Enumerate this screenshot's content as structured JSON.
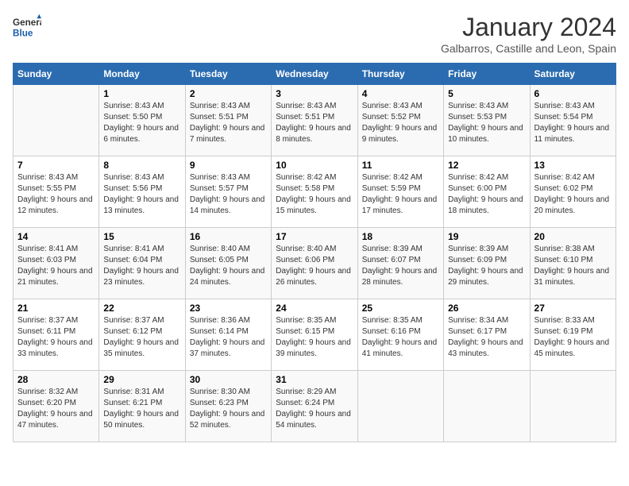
{
  "header": {
    "logo_line1": "General",
    "logo_line2": "Blue",
    "month_year": "January 2024",
    "location": "Galbarros, Castille and Leon, Spain"
  },
  "days_of_week": [
    "Sunday",
    "Monday",
    "Tuesday",
    "Wednesday",
    "Thursday",
    "Friday",
    "Saturday"
  ],
  "weeks": [
    [
      {
        "day": "",
        "sunrise": "",
        "sunset": "",
        "daylight": ""
      },
      {
        "day": "1",
        "sunrise": "Sunrise: 8:43 AM",
        "sunset": "Sunset: 5:50 PM",
        "daylight": "Daylight: 9 hours and 6 minutes."
      },
      {
        "day": "2",
        "sunrise": "Sunrise: 8:43 AM",
        "sunset": "Sunset: 5:51 PM",
        "daylight": "Daylight: 9 hours and 7 minutes."
      },
      {
        "day": "3",
        "sunrise": "Sunrise: 8:43 AM",
        "sunset": "Sunset: 5:51 PM",
        "daylight": "Daylight: 9 hours and 8 minutes."
      },
      {
        "day": "4",
        "sunrise": "Sunrise: 8:43 AM",
        "sunset": "Sunset: 5:52 PM",
        "daylight": "Daylight: 9 hours and 9 minutes."
      },
      {
        "day": "5",
        "sunrise": "Sunrise: 8:43 AM",
        "sunset": "Sunset: 5:53 PM",
        "daylight": "Daylight: 9 hours and 10 minutes."
      },
      {
        "day": "6",
        "sunrise": "Sunrise: 8:43 AM",
        "sunset": "Sunset: 5:54 PM",
        "daylight": "Daylight: 9 hours and 11 minutes."
      }
    ],
    [
      {
        "day": "7",
        "sunrise": "Sunrise: 8:43 AM",
        "sunset": "Sunset: 5:55 PM",
        "daylight": "Daylight: 9 hours and 12 minutes."
      },
      {
        "day": "8",
        "sunrise": "Sunrise: 8:43 AM",
        "sunset": "Sunset: 5:56 PM",
        "daylight": "Daylight: 9 hours and 13 minutes."
      },
      {
        "day": "9",
        "sunrise": "Sunrise: 8:43 AM",
        "sunset": "Sunset: 5:57 PM",
        "daylight": "Daylight: 9 hours and 14 minutes."
      },
      {
        "day": "10",
        "sunrise": "Sunrise: 8:42 AM",
        "sunset": "Sunset: 5:58 PM",
        "daylight": "Daylight: 9 hours and 15 minutes."
      },
      {
        "day": "11",
        "sunrise": "Sunrise: 8:42 AM",
        "sunset": "Sunset: 5:59 PM",
        "daylight": "Daylight: 9 hours and 17 minutes."
      },
      {
        "day": "12",
        "sunrise": "Sunrise: 8:42 AM",
        "sunset": "Sunset: 6:00 PM",
        "daylight": "Daylight: 9 hours and 18 minutes."
      },
      {
        "day": "13",
        "sunrise": "Sunrise: 8:42 AM",
        "sunset": "Sunset: 6:02 PM",
        "daylight": "Daylight: 9 hours and 20 minutes."
      }
    ],
    [
      {
        "day": "14",
        "sunrise": "Sunrise: 8:41 AM",
        "sunset": "Sunset: 6:03 PM",
        "daylight": "Daylight: 9 hours and 21 minutes."
      },
      {
        "day": "15",
        "sunrise": "Sunrise: 8:41 AM",
        "sunset": "Sunset: 6:04 PM",
        "daylight": "Daylight: 9 hours and 23 minutes."
      },
      {
        "day": "16",
        "sunrise": "Sunrise: 8:40 AM",
        "sunset": "Sunset: 6:05 PM",
        "daylight": "Daylight: 9 hours and 24 minutes."
      },
      {
        "day": "17",
        "sunrise": "Sunrise: 8:40 AM",
        "sunset": "Sunset: 6:06 PM",
        "daylight": "Daylight: 9 hours and 26 minutes."
      },
      {
        "day": "18",
        "sunrise": "Sunrise: 8:39 AM",
        "sunset": "Sunset: 6:07 PM",
        "daylight": "Daylight: 9 hours and 28 minutes."
      },
      {
        "day": "19",
        "sunrise": "Sunrise: 8:39 AM",
        "sunset": "Sunset: 6:09 PM",
        "daylight": "Daylight: 9 hours and 29 minutes."
      },
      {
        "day": "20",
        "sunrise": "Sunrise: 8:38 AM",
        "sunset": "Sunset: 6:10 PM",
        "daylight": "Daylight: 9 hours and 31 minutes."
      }
    ],
    [
      {
        "day": "21",
        "sunrise": "Sunrise: 8:37 AM",
        "sunset": "Sunset: 6:11 PM",
        "daylight": "Daylight: 9 hours and 33 minutes."
      },
      {
        "day": "22",
        "sunrise": "Sunrise: 8:37 AM",
        "sunset": "Sunset: 6:12 PM",
        "daylight": "Daylight: 9 hours and 35 minutes."
      },
      {
        "day": "23",
        "sunrise": "Sunrise: 8:36 AM",
        "sunset": "Sunset: 6:14 PM",
        "daylight": "Daylight: 9 hours and 37 minutes."
      },
      {
        "day": "24",
        "sunrise": "Sunrise: 8:35 AM",
        "sunset": "Sunset: 6:15 PM",
        "daylight": "Daylight: 9 hours and 39 minutes."
      },
      {
        "day": "25",
        "sunrise": "Sunrise: 8:35 AM",
        "sunset": "Sunset: 6:16 PM",
        "daylight": "Daylight: 9 hours and 41 minutes."
      },
      {
        "day": "26",
        "sunrise": "Sunrise: 8:34 AM",
        "sunset": "Sunset: 6:17 PM",
        "daylight": "Daylight: 9 hours and 43 minutes."
      },
      {
        "day": "27",
        "sunrise": "Sunrise: 8:33 AM",
        "sunset": "Sunset: 6:19 PM",
        "daylight": "Daylight: 9 hours and 45 minutes."
      }
    ],
    [
      {
        "day": "28",
        "sunrise": "Sunrise: 8:32 AM",
        "sunset": "Sunset: 6:20 PM",
        "daylight": "Daylight: 9 hours and 47 minutes."
      },
      {
        "day": "29",
        "sunrise": "Sunrise: 8:31 AM",
        "sunset": "Sunset: 6:21 PM",
        "daylight": "Daylight: 9 hours and 50 minutes."
      },
      {
        "day": "30",
        "sunrise": "Sunrise: 8:30 AM",
        "sunset": "Sunset: 6:23 PM",
        "daylight": "Daylight: 9 hours and 52 minutes."
      },
      {
        "day": "31",
        "sunrise": "Sunrise: 8:29 AM",
        "sunset": "Sunset: 6:24 PM",
        "daylight": "Daylight: 9 hours and 54 minutes."
      },
      {
        "day": "",
        "sunrise": "",
        "sunset": "",
        "daylight": ""
      },
      {
        "day": "",
        "sunrise": "",
        "sunset": "",
        "daylight": ""
      },
      {
        "day": "",
        "sunrise": "",
        "sunset": "",
        "daylight": ""
      }
    ]
  ]
}
